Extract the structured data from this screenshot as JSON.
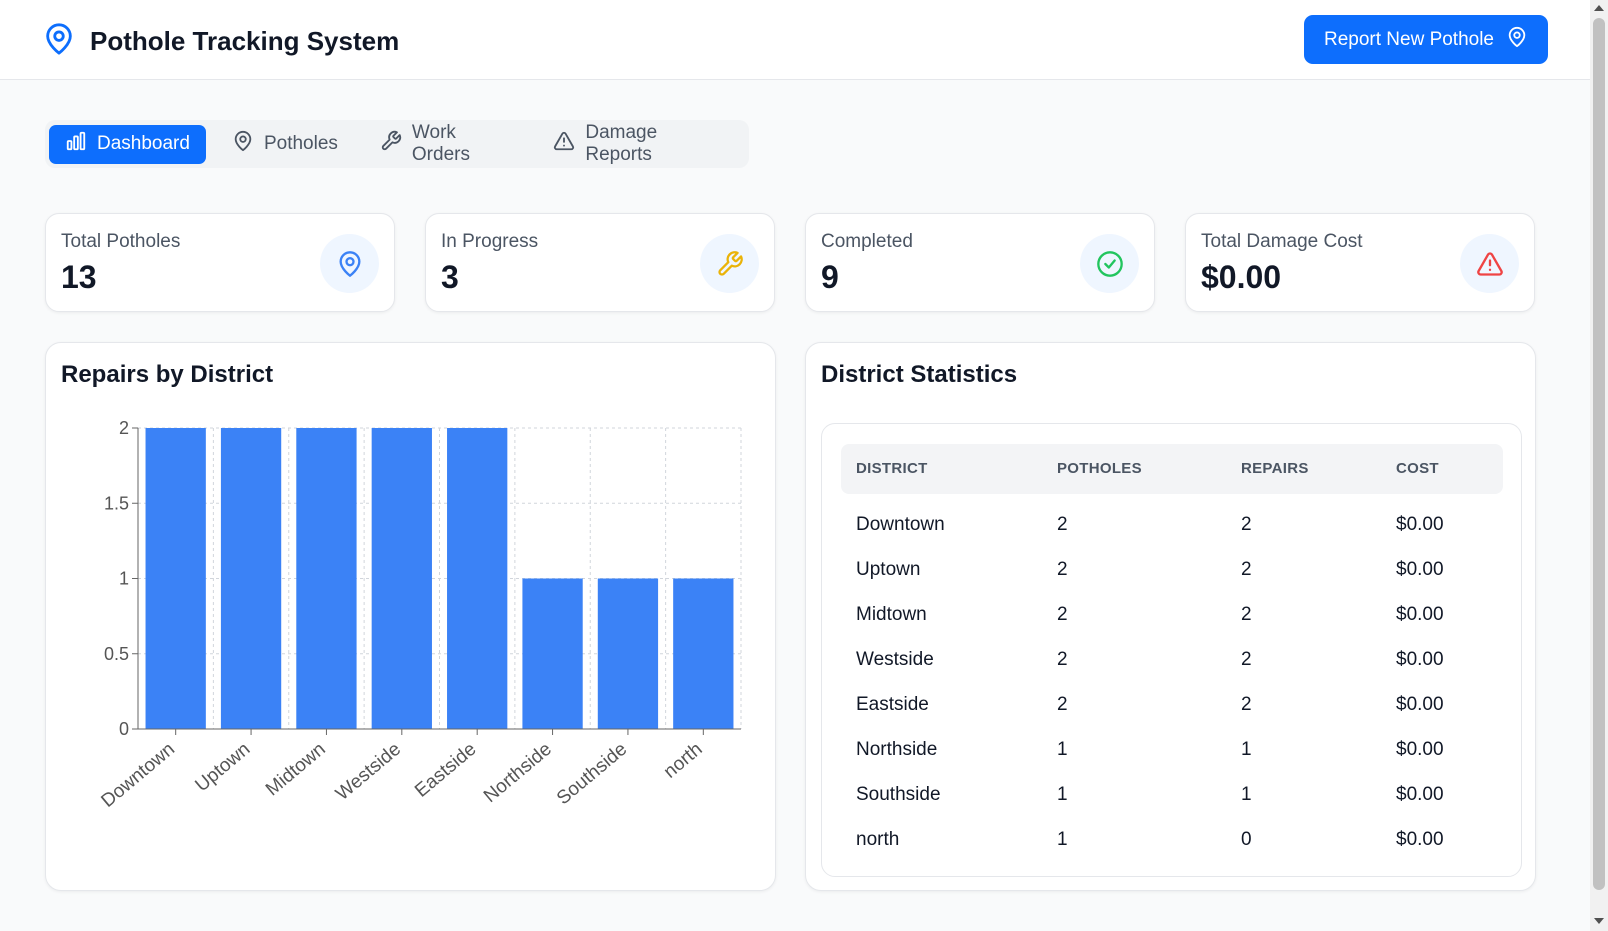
{
  "header": {
    "title": "Pothole Tracking System",
    "report_button": "Report New Pothole"
  },
  "tabs": [
    {
      "label": "Dashboard",
      "icon": "bar-chart-icon",
      "active": true
    },
    {
      "label": "Potholes",
      "icon": "map-pin-icon",
      "active": false
    },
    {
      "label": "Work Orders",
      "icon": "wrench-icon",
      "active": false
    },
    {
      "label": "Damage Reports",
      "icon": "alert-triangle-icon",
      "active": false
    }
  ],
  "stats": [
    {
      "label": "Total Potholes",
      "value": "13",
      "icon": "map-pin-icon",
      "color": "#3b82f6"
    },
    {
      "label": "In Progress",
      "value": "3",
      "icon": "wrench-icon",
      "color": "#eab308"
    },
    {
      "label": "Completed",
      "value": "9",
      "icon": "check-circle-icon",
      "color": "#22c55e"
    },
    {
      "label": "Total Damage Cost",
      "value": "$0.00",
      "icon": "alert-triangle-icon",
      "color": "#ef4444"
    }
  ],
  "repairs_panel": {
    "title": "Repairs by District"
  },
  "stats_panel": {
    "title": "District Statistics",
    "columns": [
      "DISTRICT",
      "POTHOLES",
      "REPAIRS",
      "COST"
    ],
    "rows": [
      [
        "Downtown",
        "2",
        "2",
        "$0.00"
      ],
      [
        "Uptown",
        "2",
        "2",
        "$0.00"
      ],
      [
        "Midtown",
        "2",
        "2",
        "$0.00"
      ],
      [
        "Westside",
        "2",
        "2",
        "$0.00"
      ],
      [
        "Eastside",
        "2",
        "2",
        "$0.00"
      ],
      [
        "Northside",
        "1",
        "1",
        "$0.00"
      ],
      [
        "Southside",
        "1",
        "1",
        "$0.00"
      ],
      [
        "north",
        "1",
        "0",
        "$0.00"
      ]
    ]
  },
  "colors": {
    "primary": "#0d6efd",
    "bar": "#3b82f6"
  },
  "chart_data": {
    "type": "bar",
    "categories": [
      "Downtown",
      "Uptown",
      "Midtown",
      "Westside",
      "Eastside",
      "Northside",
      "Southside",
      "north"
    ],
    "values": [
      2,
      2,
      2,
      2,
      2,
      1,
      1,
      1
    ],
    "title": "Repairs by District",
    "xlabel": "",
    "ylabel": "",
    "ylim": [
      0,
      2
    ],
    "yticks": [
      "0",
      "0.5",
      "1",
      "1.5",
      "2"
    ],
    "grid": true
  }
}
